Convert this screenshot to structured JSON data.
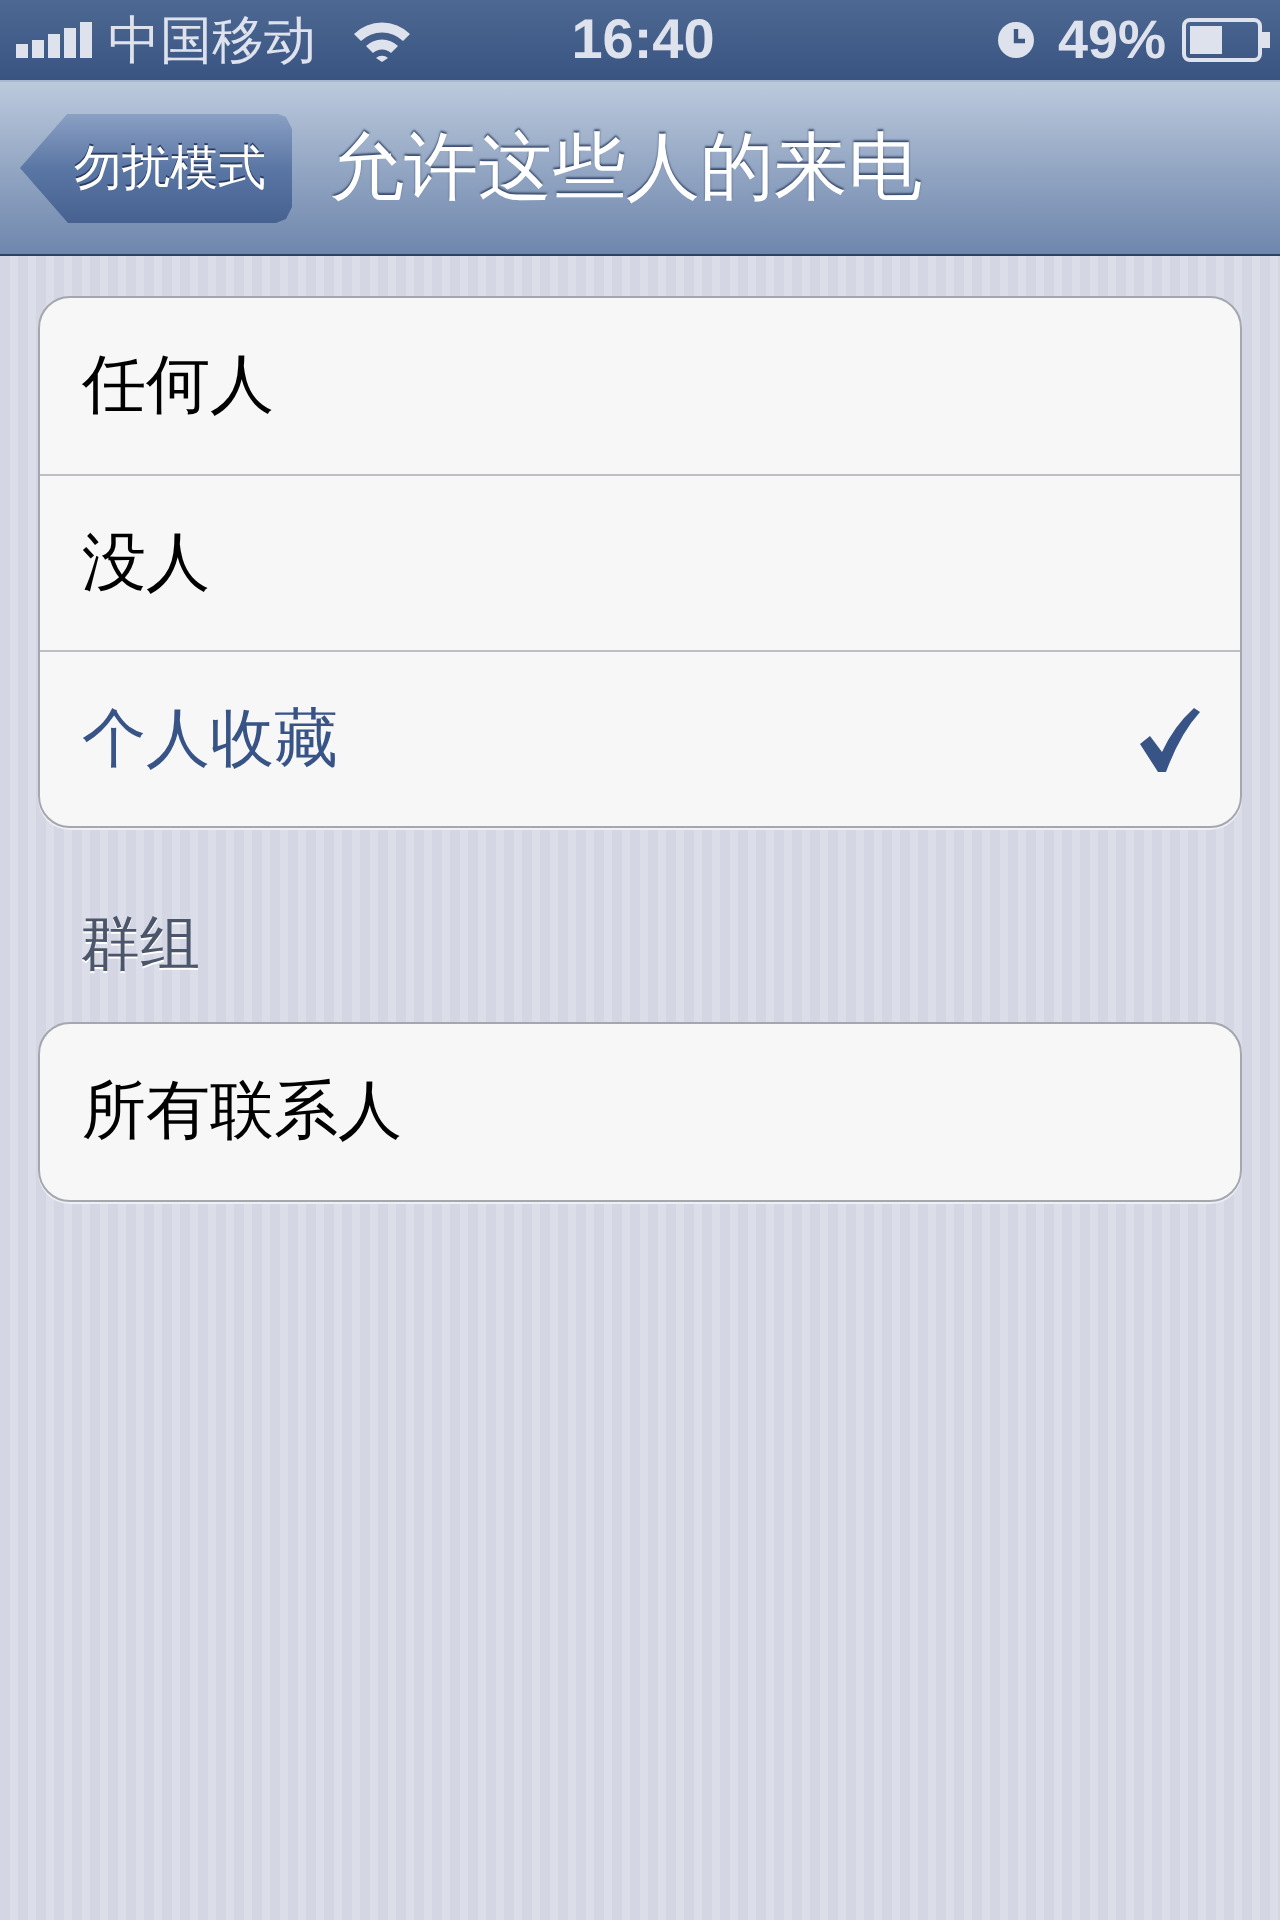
{
  "status_bar": {
    "carrier": "中国移动",
    "time": "16:40",
    "battery": "49%"
  },
  "nav_bar": {
    "back_button": "勿扰模式",
    "title": "允许这些人的来电"
  },
  "sections": [
    {
      "rows": [
        {
          "label": "任何人",
          "selected": false
        },
        {
          "label": "没人",
          "selected": false
        },
        {
          "label": "个人收藏",
          "selected": true
        }
      ]
    },
    {
      "header": "群组",
      "rows": [
        {
          "label": "所有联系人",
          "selected": false
        }
      ]
    }
  ]
}
